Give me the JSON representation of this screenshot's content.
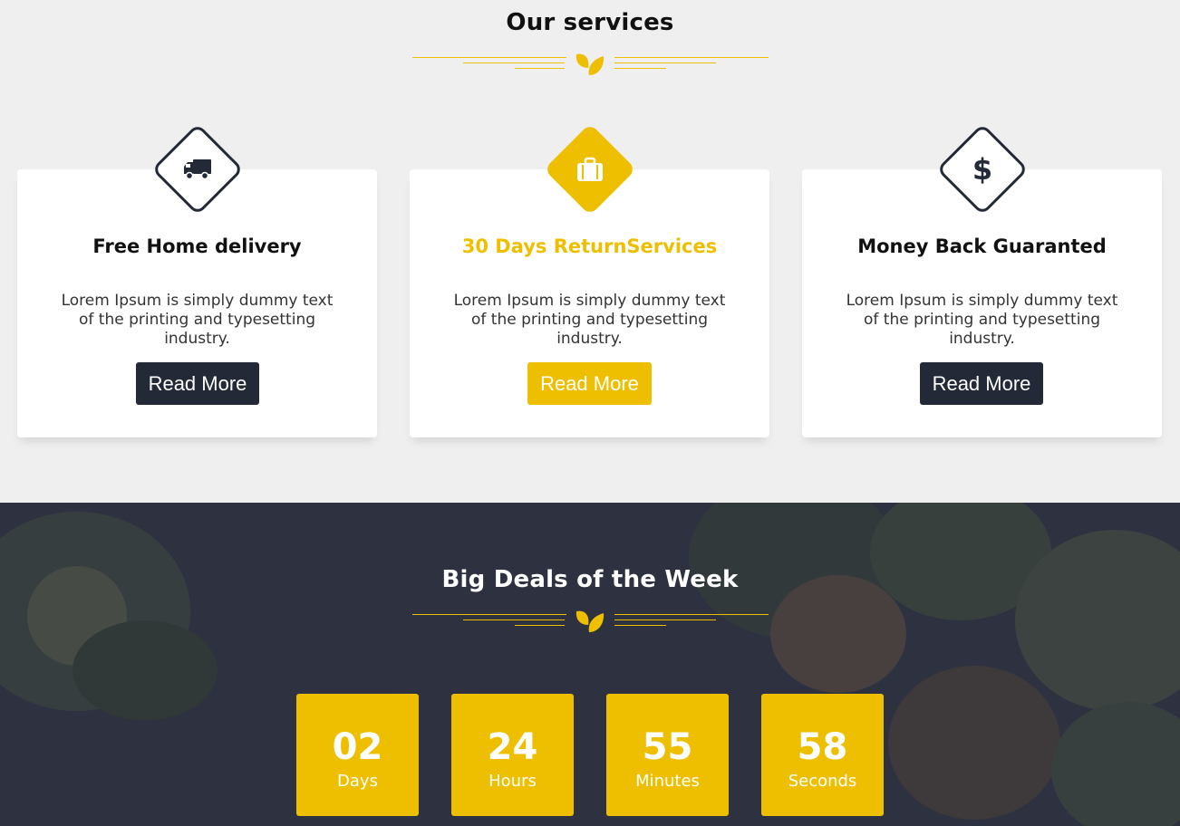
{
  "services": {
    "title": "Our services",
    "cards": [
      {
        "title": "Free Home delivery",
        "icon": "truck-icon",
        "text": "Lorem Ipsum is simply dummy text of the printing and typesetting industry.",
        "button": "Read More"
      },
      {
        "title": "30 Days ReturnServices",
        "icon": "briefcase-icon",
        "text": "Lorem Ipsum is simply dummy text of the printing and typesetting industry.",
        "button": "Read More"
      },
      {
        "title": "Money Back Guaranted",
        "icon": "dollar-icon",
        "text": "Lorem Ipsum is simply dummy text of the printing and typesetting industry.",
        "button": "Read More"
      }
    ]
  },
  "deals": {
    "title": "Big Deals of the Week",
    "countdown": [
      {
        "value": "02",
        "label": "Days"
      },
      {
        "value": "24",
        "label": "Hours"
      },
      {
        "value": "55",
        "label": "Minutes"
      },
      {
        "value": "58",
        "label": "Seconds"
      }
    ]
  },
  "colors": {
    "accent": "#eebf00",
    "dark": "#232937",
    "background": "#efefef"
  }
}
